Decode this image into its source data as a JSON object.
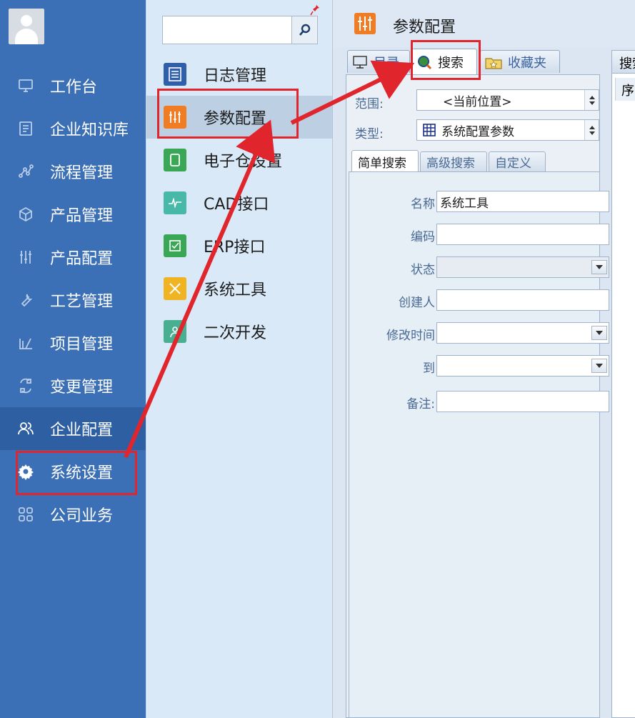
{
  "nav": {
    "items": [
      {
        "label": "工作台",
        "icon": "monitor-icon"
      },
      {
        "label": "企业知识库",
        "icon": "book-icon"
      },
      {
        "label": "流程管理",
        "icon": "flow-icon"
      },
      {
        "label": "产品管理",
        "icon": "cube-icon"
      },
      {
        "label": "产品配置",
        "icon": "sliders-icon"
      },
      {
        "label": "工艺管理",
        "icon": "wrench-icon"
      },
      {
        "label": "项目管理",
        "icon": "chart-icon"
      },
      {
        "label": "变更管理",
        "icon": "cycle-icon"
      },
      {
        "label": "企业配置",
        "icon": "users-icon"
      },
      {
        "label": "系统设置",
        "icon": "gear-icon"
      },
      {
        "label": "公司业务",
        "icon": "grid-icon"
      }
    ]
  },
  "mid": {
    "search_value": "",
    "items": [
      {
        "label": "日志管理",
        "icon": "log-icon",
        "color": "#2f5fa8"
      },
      {
        "label": "参数配置",
        "icon": "params-icon",
        "color": "#f07d23"
      },
      {
        "label": "电子仓设置",
        "icon": "tablet-icon",
        "color": "#3aa756"
      },
      {
        "label": "CAD接口",
        "icon": "cad-icon",
        "color": "#48b8a8"
      },
      {
        "label": "ERP接口",
        "icon": "erp-icon",
        "color": "#3aa756"
      },
      {
        "label": "系统工具",
        "icon": "tools-icon",
        "color": "#f0b321"
      },
      {
        "label": "二次开发",
        "icon": "dev-icon",
        "color": "#48b090"
      }
    ]
  },
  "right": {
    "title": "参数配置",
    "tabs": {
      "catalog": "目录",
      "search": "搜索",
      "favorites": "收藏夹"
    },
    "scope_label": "范围:",
    "scope_value": "<当前位置>",
    "type_label": "类型:",
    "type_value": "系统配置参数",
    "subtabs": {
      "simple": "简单搜索",
      "advanced": "高级搜索",
      "custom": "自定义"
    },
    "fields": {
      "name_label": "名称",
      "name_value": "系统工具",
      "code_label": "编码",
      "code_value": "",
      "status_label": "状态",
      "status_value": "",
      "creator_label": "创建人",
      "creator_value": "",
      "modified_label": "修改时间",
      "modified_value": "",
      "to_label": "到",
      "to_value": "",
      "note_label": "备注:",
      "note_value": ""
    },
    "result_tab": "搜索",
    "result_col": "序"
  }
}
